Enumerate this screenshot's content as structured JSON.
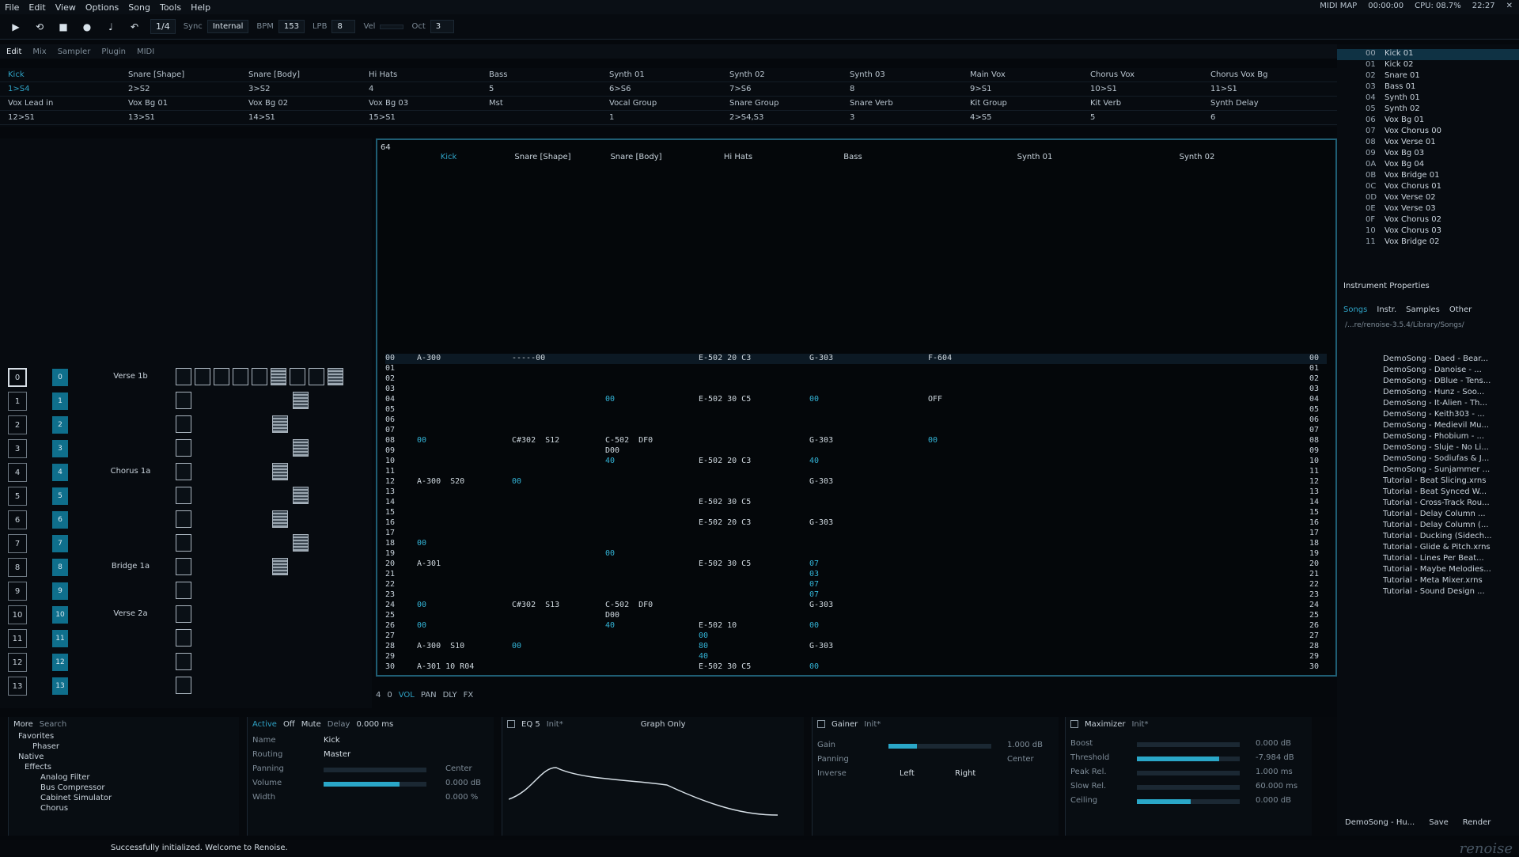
{
  "menu": {
    "items": [
      "File",
      "Edit",
      "View",
      "Options",
      "Song",
      "Tools",
      "Help"
    ],
    "midi_map": "MIDI MAP",
    "time": "00:00:00",
    "cpu": "CPU: 08.7%",
    "clock": "22:27"
  },
  "toolbar": {
    "pattern_step": "1/4",
    "sync_label": "Sync",
    "sync_value": "Internal",
    "bpm_label": "BPM",
    "bpm": "153",
    "lpb_label": "LPB",
    "lpb": "8",
    "vel_label": "Vel",
    "oct_label": "Oct",
    "oct": "3"
  },
  "viewtabs": {
    "edit": "Edit",
    "mix": "Mix",
    "sampler": "Sampler",
    "plugin": "Plugin",
    "midi": "MIDI"
  },
  "sendtable": [
    [
      "Kick",
      "Snare [Shape]",
      "Snare [Body]",
      "Hi Hats",
      "Bass",
      "Synth 01",
      "Synth 02",
      "Synth 03",
      "Main Vox",
      "Chorus Vox",
      "Chorus Vox Bg"
    ],
    [
      "1>S4",
      "2>S2",
      "3>S2",
      "4",
      "5",
      "6>S6",
      "7>S6",
      "8",
      "9>S1",
      "10>S1",
      "11>S1"
    ],
    [
      "Vox Lead in",
      "Vox Bg 01",
      "Vox Bg 02",
      "Vox Bg 03",
      "Mst",
      "Vocal Group",
      "Snare Group",
      "Snare Verb",
      "Kit Group",
      "Kit Verb",
      "Synth Delay"
    ],
    [
      "12>S1",
      "13>S1",
      "14>S1",
      "15>S1",
      "",
      "1",
      "2>S4,S3",
      "3",
      "4>S5",
      "5",
      "6"
    ]
  ],
  "sequence": [
    {
      "num": "0",
      "idx": "0",
      "name": "Verse 1b"
    },
    {
      "num": "1",
      "idx": "1",
      "name": ""
    },
    {
      "num": "2",
      "idx": "2",
      "name": ""
    },
    {
      "num": "3",
      "idx": "3",
      "name": ""
    },
    {
      "num": "4",
      "idx": "4",
      "name": "Chorus 1a"
    },
    {
      "num": "5",
      "idx": "5",
      "name": ""
    },
    {
      "num": "6",
      "idx": "6",
      "name": ""
    },
    {
      "num": "7",
      "idx": "7",
      "name": ""
    },
    {
      "num": "8",
      "idx": "8",
      "name": "Bridge 1a"
    },
    {
      "num": "9",
      "idx": "9",
      "name": ""
    },
    {
      "num": "10",
      "idx": "10",
      "name": "Verse 2a"
    },
    {
      "num": "11",
      "idx": "11",
      "name": ""
    },
    {
      "num": "12",
      "idx": "12",
      "name": ""
    },
    {
      "num": "13",
      "idx": "13",
      "name": ""
    }
  ],
  "pattern": {
    "length": "64",
    "tracks": [
      "Kick",
      "Snare [Shape]",
      "Snare [Body]",
      "Hi Hats",
      "Bass",
      "Synth 01",
      "Synth 02"
    ],
    "rows": [
      {
        "ln": "00",
        "a": "A-300",
        "b": "-----00",
        "c": "",
        "d": "E-502 20 C3",
        "e": "G-303",
        "f": "F-604"
      },
      {
        "ln": "01",
        "a": "",
        "b": "",
        "c": "",
        "d": "",
        "e": "",
        "f": ""
      },
      {
        "ln": "02",
        "a": "",
        "b": "",
        "c": "",
        "d": "",
        "e": "",
        "f": ""
      },
      {
        "ln": "03",
        "a": "",
        "b": "",
        "c": "",
        "d": "",
        "e": "",
        "f": ""
      },
      {
        "ln": "04",
        "a": "",
        "b": "",
        "c": "00",
        "d": "E-502 30 C5",
        "e": "00",
        "f": "OFF"
      },
      {
        "ln": "05",
        "a": "",
        "b": "",
        "c": "",
        "d": "",
        "e": "",
        "f": ""
      },
      {
        "ln": "06",
        "a": "",
        "b": "",
        "c": "",
        "d": "",
        "e": "",
        "f": ""
      },
      {
        "ln": "07",
        "a": "",
        "b": "",
        "c": "",
        "d": "",
        "e": "",
        "f": ""
      },
      {
        "ln": "08",
        "a": "00",
        "b": "C#302  S12",
        "c": "C-502  DF0",
        "d": "",
        "e": "G-303",
        "f": "00"
      },
      {
        "ln": "09",
        "a": "",
        "b": "",
        "c": "D00",
        "d": "",
        "e": "",
        "f": ""
      },
      {
        "ln": "10",
        "a": "",
        "b": "",
        "c": "40",
        "d": "E-502 20 C3",
        "e": "40",
        "f": ""
      },
      {
        "ln": "11",
        "a": "",
        "b": "",
        "c": "",
        "d": "",
        "e": "",
        "f": ""
      },
      {
        "ln": "12",
        "a": "A-300  S20",
        "b": "00",
        "c": "",
        "d": "",
        "e": "G-303",
        "f": ""
      },
      {
        "ln": "13",
        "a": "",
        "b": "",
        "c": "",
        "d": "",
        "e": "",
        "f": ""
      },
      {
        "ln": "14",
        "a": "",
        "b": "",
        "c": "",
        "d": "E-502 30 C5",
        "e": "",
        "f": ""
      },
      {
        "ln": "15",
        "a": "",
        "b": "",
        "c": "",
        "d": "",
        "e": "",
        "f": ""
      },
      {
        "ln": "16",
        "a": "",
        "b": "",
        "c": "",
        "d": "E-502 20 C3",
        "e": "G-303",
        "f": ""
      },
      {
        "ln": "17",
        "a": "",
        "b": "",
        "c": "",
        "d": "",
        "e": "",
        "f": ""
      },
      {
        "ln": "18",
        "a": "00",
        "b": "",
        "c": "",
        "d": "",
        "e": "",
        "f": ""
      },
      {
        "ln": "19",
        "a": "",
        "b": "",
        "c": "00",
        "d": "",
        "e": "",
        "f": ""
      },
      {
        "ln": "20",
        "a": "A-301",
        "b": "",
        "c": "",
        "d": "E-502 30 C5",
        "e": "07",
        "f": ""
      },
      {
        "ln": "21",
        "a": "",
        "b": "",
        "c": "",
        "d": "",
        "e": "03",
        "f": ""
      },
      {
        "ln": "22",
        "a": "",
        "b": "",
        "c": "",
        "d": "",
        "e": "07",
        "f": ""
      },
      {
        "ln": "23",
        "a": "",
        "b": "",
        "c": "",
        "d": "",
        "e": "07",
        "f": ""
      },
      {
        "ln": "24",
        "a": "00",
        "b": "C#302  S13",
        "c": "C-502  DF0",
        "d": "",
        "e": "G-303",
        "f": ""
      },
      {
        "ln": "25",
        "a": "",
        "b": "",
        "c": "D00",
        "d": "",
        "e": "",
        "f": ""
      },
      {
        "ln": "26",
        "a": "00",
        "b": "",
        "c": "40",
        "d": "E-502 10",
        "e": "00",
        "f": ""
      },
      {
        "ln": "27",
        "a": "",
        "b": "",
        "c": "",
        "d": "00",
        "e": "",
        "f": ""
      },
      {
        "ln": "28",
        "a": "A-300  S10",
        "b": "00",
        "c": "",
        "d": "80",
        "e": "G-303",
        "f": ""
      },
      {
        "ln": "29",
        "a": "",
        "b": "",
        "c": "",
        "d": "40",
        "e": "",
        "f": ""
      },
      {
        "ln": "30",
        "a": "A-301 10 R04",
        "b": "",
        "c": "",
        "d": "E-502 30 C5",
        "e": "00",
        "f": ""
      }
    ]
  },
  "patbot": {
    "step": "4",
    "offset": "0",
    "vol": "VOL",
    "pan": "PAN",
    "dly": "DLY",
    "fx": "FX"
  },
  "instruments": [
    {
      "no": "00",
      "name": "Kick 01"
    },
    {
      "no": "01",
      "name": "Kick 02"
    },
    {
      "no": "02",
      "name": "Snare 01"
    },
    {
      "no": "03",
      "name": "Bass 01"
    },
    {
      "no": "04",
      "name": "Synth 01"
    },
    {
      "no": "05",
      "name": "Synth 02"
    },
    {
      "no": "06",
      "name": "Vox Bg 01"
    },
    {
      "no": "07",
      "name": "Vox Chorus 00"
    },
    {
      "no": "08",
      "name": "Vox Verse 01"
    },
    {
      "no": "09",
      "name": "Vox Bg 03"
    },
    {
      "no": "0A",
      "name": "Vox Bg 04"
    },
    {
      "no": "0B",
      "name": "Vox Bridge 01"
    },
    {
      "no": "0C",
      "name": "Vox Chorus 01"
    },
    {
      "no": "0D",
      "name": "Vox Verse 02"
    },
    {
      "no": "0E",
      "name": "Vox Verse 03"
    },
    {
      "no": "0F",
      "name": "Vox Chorus 02"
    },
    {
      "no": "10",
      "name": "Vox Chorus 03"
    },
    {
      "no": "11",
      "name": "Vox Bridge 02"
    }
  ],
  "instr_props": {
    "title": "Instrument Properties",
    "tabs": [
      "Songs",
      "Instr.",
      "Samples",
      "Other"
    ],
    "path": "/...re/renoise-3.5.4/Library/Songs/"
  },
  "files": [
    "DemoSong - Daed - Bear...",
    "DemoSong - Danoise - ...",
    "DemoSong - DBlue - Tens...",
    "DemoSong - Hunz - Soo...",
    "DemoSong - It-Alien - Th...",
    "DemoSong - Keith303 - ...",
    "DemoSong - Medievil Mu...",
    "DemoSong - Phobium - ...",
    "DemoSong - Sluje - No Li...",
    "DemoSong - Sodiufas & J...",
    "DemoSong - Sunjammer ...",
    "Tutorial - Beat Slicing.xrns",
    "Tutorial - Beat Synced W...",
    "Tutorial - Cross-Track Rou...",
    "Tutorial - Delay Column ...",
    "Tutorial - Delay Column (...",
    "Tutorial - Ducking (Sidech...",
    "Tutorial - Glide & Pitch.xrns",
    "Tutorial - Lines Per Beat...",
    "Tutorial - Maybe Melodies...",
    "Tutorial - Meta Mixer.xrns",
    "Tutorial - Sound Design ..."
  ],
  "right_bottom": {
    "song": "DemoSong - Hu...",
    "save": "Save",
    "render": "Render"
  },
  "browser": {
    "more": "More",
    "search": "Search",
    "favorites": "Favorites",
    "phaser": "Phaser",
    "native": "Native",
    "effects": "Effects",
    "items": [
      "Analog Filter",
      "Bus Compressor",
      "Cabinet Simulator",
      "Chorus"
    ]
  },
  "trackdsp": {
    "active": "Active",
    "off": "Off",
    "mute": "Mute",
    "delay_label": "Delay",
    "delay": "0.000 ms",
    "name_label": "Name",
    "name": "Kick",
    "routing_label": "Routing",
    "routing": "Master",
    "panning_label": "Panning",
    "center": "Center",
    "volume_label": "Volume",
    "volume": "0.000 dB",
    "width_label": "Width",
    "width": "0.000 %"
  },
  "eq": {
    "title": "EQ 5",
    "preset": "Init*",
    "mode": "Graph Only"
  },
  "gainer": {
    "title": "Gainer",
    "preset": "Init*",
    "gain_label": "Gain",
    "gain": "1.000 dB",
    "panning_label": "Panning",
    "panning": "Center",
    "inverse_label": "Inverse",
    "left": "Left",
    "right": "Right"
  },
  "maximizer": {
    "title": "Maximizer",
    "preset": "Init*",
    "boost_label": "Boost",
    "boost": "0.000 dB",
    "threshold_label": "Threshold",
    "threshold": "-7.984 dB",
    "peak_label": "Peak Rel.",
    "peak": "1.000 ms",
    "slow_label": "Slow Rel.",
    "slow": "60.000 ms",
    "ceiling_label": "Ceiling",
    "ceiling": "0.000 dB"
  },
  "status": {
    "message": "Successfully initialized. Welcome to Renoise.",
    "logo": "renoise"
  }
}
